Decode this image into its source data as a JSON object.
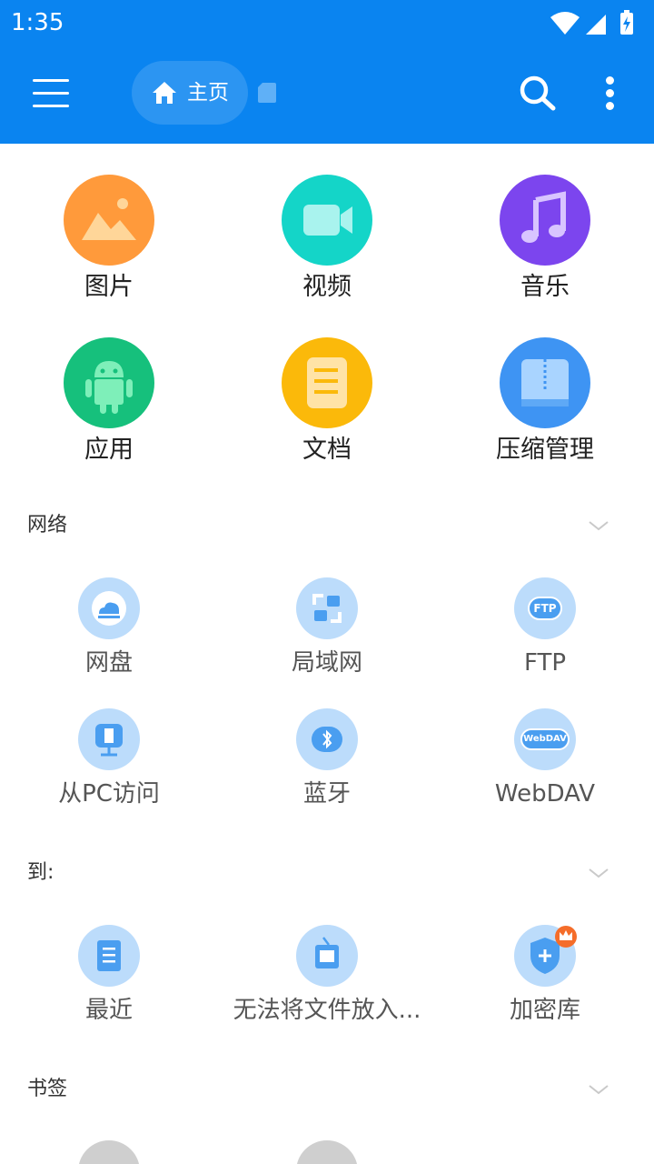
{
  "status": {
    "time": "1:35"
  },
  "toolbar": {
    "breadcrumb_label": "主页"
  },
  "categories": [
    {
      "label": "图片",
      "color": "#ff9a3b"
    },
    {
      "label": "视频",
      "color": "#14d5c8"
    },
    {
      "label": "音乐",
      "color": "#7c45ee"
    },
    {
      "label": "应用",
      "color": "#16c07c"
    },
    {
      "label": "文档",
      "color": "#fbb90a"
    },
    {
      "label": "压缩管理",
      "color": "#3e94f3"
    }
  ],
  "sections": {
    "network": {
      "title": "网络",
      "items": [
        {
          "label": "网盘"
        },
        {
          "label": "局域网"
        },
        {
          "label": "FTP",
          "icon_text": "FTP"
        },
        {
          "label": "从PC访问"
        },
        {
          "label": "蓝牙"
        },
        {
          "label": "WebDAV",
          "icon_text": "WebDAV"
        }
      ]
    },
    "goto": {
      "title": "到:",
      "items": [
        {
          "label": "最近"
        },
        {
          "label": "无法将文件放入..."
        },
        {
          "label": "加密库"
        }
      ]
    },
    "bookmarks": {
      "title": "书签"
    }
  },
  "colors": {
    "toolbar": "#0a84f0",
    "tool_circle": "#bcdcfb",
    "tool_icon": "#4a9ef0"
  }
}
